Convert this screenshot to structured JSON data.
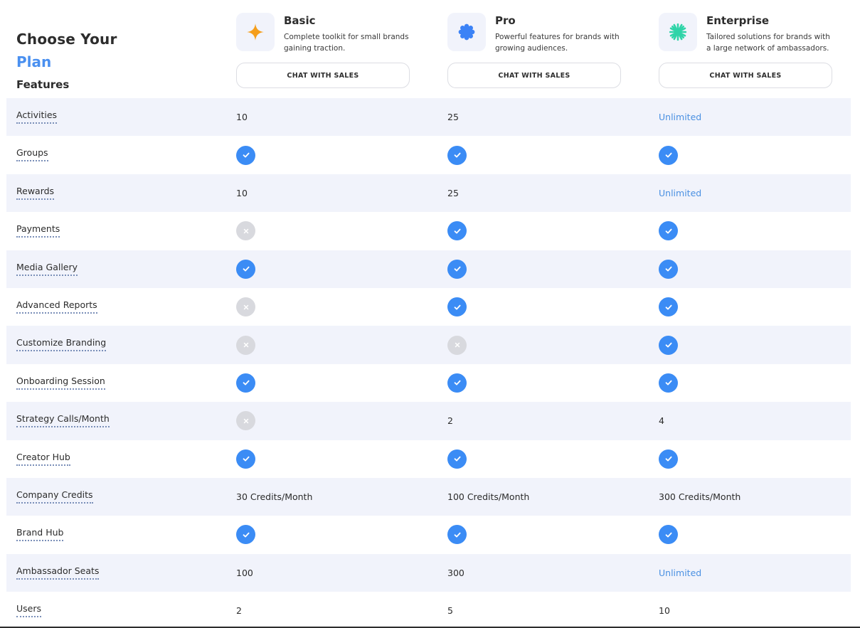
{
  "heading": {
    "line1": "Choose Your",
    "line2": "Plan"
  },
  "features_title": "Features",
  "colors": {
    "accent": "#4a90f0",
    "check": "#3b8cf5",
    "cross": "#d8d9de",
    "row_alt": "#f1f3fb"
  },
  "plans": [
    {
      "name": "Basic",
      "description": "Complete toolkit for small brands gaining traction.",
      "cta": "CHAT WITH SALES",
      "icon": "sparkle-icon"
    },
    {
      "name": "Pro",
      "description": "Powerful features for brands with growing audiences.",
      "cta": "CHAT WITH SALES",
      "icon": "badge-icon"
    },
    {
      "name": "Enterprise",
      "description": "Tailored solutions for brands with a large network of ambassadors.",
      "cta": "CHAT WITH SALES",
      "icon": "asterisk-icon"
    }
  ],
  "rows": [
    {
      "feature": "Activities",
      "values": [
        "10",
        "25",
        "Unlimited"
      ]
    },
    {
      "feature": "Groups",
      "values": [
        "check",
        "check",
        "check"
      ]
    },
    {
      "feature": "Rewards",
      "values": [
        "10",
        "25",
        "Unlimited"
      ]
    },
    {
      "feature": "Payments",
      "values": [
        "cross",
        "check",
        "check"
      ]
    },
    {
      "feature": "Media Gallery",
      "values": [
        "check",
        "check",
        "check"
      ]
    },
    {
      "feature": "Advanced Reports",
      "values": [
        "cross",
        "check",
        "check"
      ]
    },
    {
      "feature": "Customize Branding",
      "values": [
        "cross",
        "cross",
        "check"
      ]
    },
    {
      "feature": "Onboarding Session",
      "values": [
        "check",
        "check",
        "check"
      ]
    },
    {
      "feature": "Strategy Calls/Month",
      "values": [
        "cross",
        "2",
        "4"
      ]
    },
    {
      "feature": "Creator Hub",
      "values": [
        "check",
        "check",
        "check"
      ]
    },
    {
      "feature": "Company Credits",
      "values": [
        "30 Credits/Month",
        "100 Credits/Month",
        "300 Credits/Month"
      ]
    },
    {
      "feature": "Brand Hub",
      "values": [
        "check",
        "check",
        "check"
      ]
    },
    {
      "feature": "Ambassador Seats",
      "values": [
        "100",
        "300",
        "Unlimited"
      ]
    },
    {
      "feature": "Users",
      "values": [
        "2",
        "5",
        "10"
      ]
    }
  ]
}
